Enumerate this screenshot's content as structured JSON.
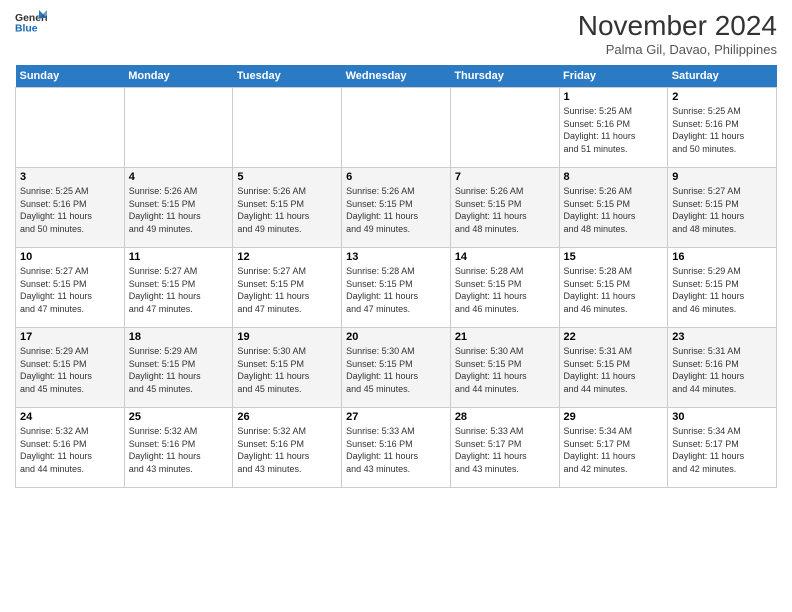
{
  "header": {
    "logo_line1": "General",
    "logo_line2": "Blue",
    "month_title": "November 2024",
    "subtitle": "Palma Gil, Davao, Philippines"
  },
  "weekdays": [
    "Sunday",
    "Monday",
    "Tuesday",
    "Wednesday",
    "Thursday",
    "Friday",
    "Saturday"
  ],
  "weeks": [
    [
      {
        "day": "",
        "info": ""
      },
      {
        "day": "",
        "info": ""
      },
      {
        "day": "",
        "info": ""
      },
      {
        "day": "",
        "info": ""
      },
      {
        "day": "",
        "info": ""
      },
      {
        "day": "1",
        "info": "Sunrise: 5:25 AM\nSunset: 5:16 PM\nDaylight: 11 hours\nand 51 minutes."
      },
      {
        "day": "2",
        "info": "Sunrise: 5:25 AM\nSunset: 5:16 PM\nDaylight: 11 hours\nand 50 minutes."
      }
    ],
    [
      {
        "day": "3",
        "info": "Sunrise: 5:25 AM\nSunset: 5:16 PM\nDaylight: 11 hours\nand 50 minutes."
      },
      {
        "day": "4",
        "info": "Sunrise: 5:26 AM\nSunset: 5:15 PM\nDaylight: 11 hours\nand 49 minutes."
      },
      {
        "day": "5",
        "info": "Sunrise: 5:26 AM\nSunset: 5:15 PM\nDaylight: 11 hours\nand 49 minutes."
      },
      {
        "day": "6",
        "info": "Sunrise: 5:26 AM\nSunset: 5:15 PM\nDaylight: 11 hours\nand 49 minutes."
      },
      {
        "day": "7",
        "info": "Sunrise: 5:26 AM\nSunset: 5:15 PM\nDaylight: 11 hours\nand 48 minutes."
      },
      {
        "day": "8",
        "info": "Sunrise: 5:26 AM\nSunset: 5:15 PM\nDaylight: 11 hours\nand 48 minutes."
      },
      {
        "day": "9",
        "info": "Sunrise: 5:27 AM\nSunset: 5:15 PM\nDaylight: 11 hours\nand 48 minutes."
      }
    ],
    [
      {
        "day": "10",
        "info": "Sunrise: 5:27 AM\nSunset: 5:15 PM\nDaylight: 11 hours\nand 47 minutes."
      },
      {
        "day": "11",
        "info": "Sunrise: 5:27 AM\nSunset: 5:15 PM\nDaylight: 11 hours\nand 47 minutes."
      },
      {
        "day": "12",
        "info": "Sunrise: 5:27 AM\nSunset: 5:15 PM\nDaylight: 11 hours\nand 47 minutes."
      },
      {
        "day": "13",
        "info": "Sunrise: 5:28 AM\nSunset: 5:15 PM\nDaylight: 11 hours\nand 47 minutes."
      },
      {
        "day": "14",
        "info": "Sunrise: 5:28 AM\nSunset: 5:15 PM\nDaylight: 11 hours\nand 46 minutes."
      },
      {
        "day": "15",
        "info": "Sunrise: 5:28 AM\nSunset: 5:15 PM\nDaylight: 11 hours\nand 46 minutes."
      },
      {
        "day": "16",
        "info": "Sunrise: 5:29 AM\nSunset: 5:15 PM\nDaylight: 11 hours\nand 46 minutes."
      }
    ],
    [
      {
        "day": "17",
        "info": "Sunrise: 5:29 AM\nSunset: 5:15 PM\nDaylight: 11 hours\nand 45 minutes."
      },
      {
        "day": "18",
        "info": "Sunrise: 5:29 AM\nSunset: 5:15 PM\nDaylight: 11 hours\nand 45 minutes."
      },
      {
        "day": "19",
        "info": "Sunrise: 5:30 AM\nSunset: 5:15 PM\nDaylight: 11 hours\nand 45 minutes."
      },
      {
        "day": "20",
        "info": "Sunrise: 5:30 AM\nSunset: 5:15 PM\nDaylight: 11 hours\nand 45 minutes."
      },
      {
        "day": "21",
        "info": "Sunrise: 5:30 AM\nSunset: 5:15 PM\nDaylight: 11 hours\nand 44 minutes."
      },
      {
        "day": "22",
        "info": "Sunrise: 5:31 AM\nSunset: 5:15 PM\nDaylight: 11 hours\nand 44 minutes."
      },
      {
        "day": "23",
        "info": "Sunrise: 5:31 AM\nSunset: 5:16 PM\nDaylight: 11 hours\nand 44 minutes."
      }
    ],
    [
      {
        "day": "24",
        "info": "Sunrise: 5:32 AM\nSunset: 5:16 PM\nDaylight: 11 hours\nand 44 minutes."
      },
      {
        "day": "25",
        "info": "Sunrise: 5:32 AM\nSunset: 5:16 PM\nDaylight: 11 hours\nand 43 minutes."
      },
      {
        "day": "26",
        "info": "Sunrise: 5:32 AM\nSunset: 5:16 PM\nDaylight: 11 hours\nand 43 minutes."
      },
      {
        "day": "27",
        "info": "Sunrise: 5:33 AM\nSunset: 5:16 PM\nDaylight: 11 hours\nand 43 minutes."
      },
      {
        "day": "28",
        "info": "Sunrise: 5:33 AM\nSunset: 5:17 PM\nDaylight: 11 hours\nand 43 minutes."
      },
      {
        "day": "29",
        "info": "Sunrise: 5:34 AM\nSunset: 5:17 PM\nDaylight: 11 hours\nand 42 minutes."
      },
      {
        "day": "30",
        "info": "Sunrise: 5:34 AM\nSunset: 5:17 PM\nDaylight: 11 hours\nand 42 minutes."
      }
    ]
  ]
}
